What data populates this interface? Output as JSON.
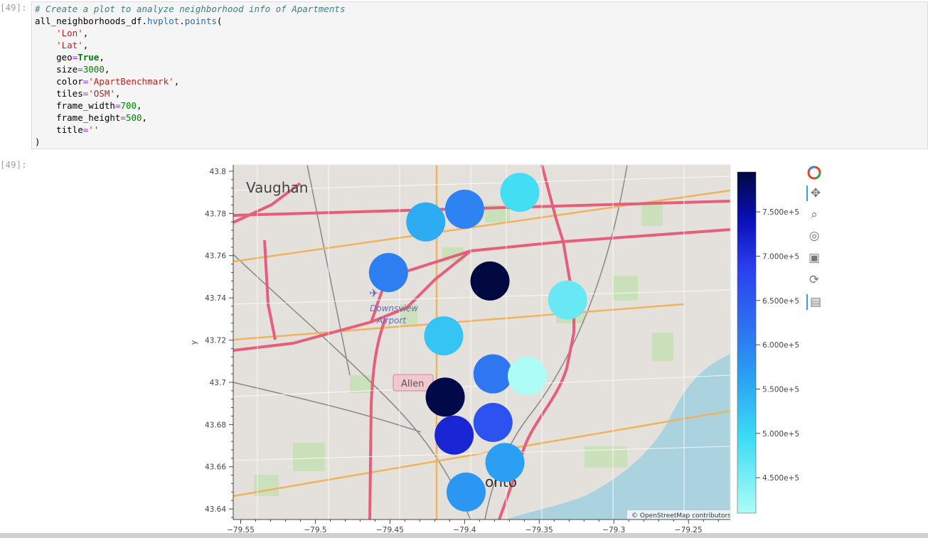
{
  "cell": {
    "in_prompt": "[49]:",
    "out_prompt": "[49]:",
    "code": {
      "comment": "# Create a plot to analyze neighborhood info of Apartments",
      "obj": "all_neighborhoods_df",
      "accessor": "hvplot",
      "method": "points",
      "arg_lon": "'Lon'",
      "arg_lat": "'Lat'",
      "kw_geo": "geo",
      "val_geo": "True",
      "kw_size": "size",
      "val_size": "3000",
      "kw_color": "color",
      "val_color": "'ApartBenchmark'",
      "kw_tiles": "tiles",
      "val_tiles": "'OSM'",
      "kw_fw": "frame_width",
      "val_fw": "700",
      "kw_fh": "frame_height",
      "val_fh": "500",
      "kw_title": "title",
      "val_title": "''"
    }
  },
  "plot": {
    "ylabel": "y",
    "attribution": "© OpenStreetMap contributors",
    "map_labels": {
      "vaughan": "Vaughan",
      "downsview": "Downsview",
      "airport": "Airport",
      "allen": "Allen",
      "toronto": "onto"
    },
    "x_ticks": [
      "−79.55",
      "−79.5",
      "−79.45",
      "−79.4",
      "−79.35",
      "−79.3",
      "−79.25"
    ],
    "y_ticks": [
      "43.8",
      "43.78",
      "43.76",
      "43.74",
      "43.72",
      "43.7",
      "43.68",
      "43.66",
      "43.64"
    ],
    "colorbar_ticks": [
      "7.500e+5",
      "7.000e+5",
      "6.500e+5",
      "6.000e+5",
      "5.500e+5",
      "5.000e+5",
      "4.500e+5"
    ],
    "colorbar_colors": [
      "#aefcf6",
      "#3ddcf4",
      "#2aa0f3",
      "#2f6df0",
      "#2a3ff0",
      "#0b0fb8",
      "#000840"
    ]
  },
  "chart_data": {
    "type": "scatter",
    "xlabel": "",
    "ylabel": "y",
    "xlim": [
      -79.555,
      -79.222
    ],
    "ylim": [
      43.635,
      43.803
    ],
    "color_field": "ApartBenchmark",
    "clim": [
      410000,
      795000
    ],
    "points": [
      {
        "x": -79.363,
        "y": 43.79,
        "value": 470000
      },
      {
        "x": -79.4,
        "y": 43.782,
        "value": 575000
      },
      {
        "x": -79.426,
        "y": 43.776,
        "value": 525000
      },
      {
        "x": -79.451,
        "y": 43.752,
        "value": 580000
      },
      {
        "x": -79.383,
        "y": 43.748,
        "value": 795000
      },
      {
        "x": -79.331,
        "y": 43.739,
        "value": 450000
      },
      {
        "x": -79.414,
        "y": 43.722,
        "value": 500000
      },
      {
        "x": -79.381,
        "y": 43.704,
        "value": 590000
      },
      {
        "x": -79.358,
        "y": 43.703,
        "value": 410000
      },
      {
        "x": -79.413,
        "y": 43.693,
        "value": 790000
      },
      {
        "x": -79.381,
        "y": 43.681,
        "value": 640000
      },
      {
        "x": -79.407,
        "y": 43.675,
        "value": 700000
      },
      {
        "x": -79.373,
        "y": 43.662,
        "value": 540000
      },
      {
        "x": -79.399,
        "y": 43.648,
        "value": 550000
      }
    ]
  },
  "toolbar": {
    "tools": [
      "bokeh-logo-icon",
      "pan-icon",
      "box-zoom-icon",
      "wheel-zoom-icon",
      "save-icon",
      "reset-icon",
      "hover-icon"
    ]
  }
}
